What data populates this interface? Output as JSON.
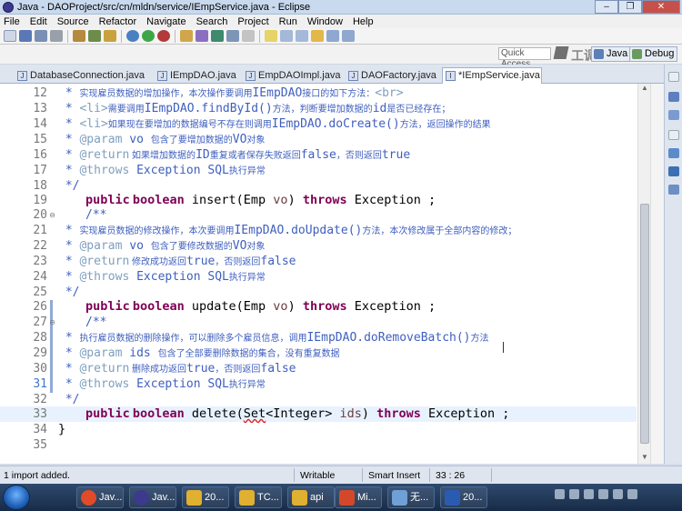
{
  "window": {
    "title": "Java - DAOProject/src/cn/mldn/service/IEmpService.java - Eclipse",
    "controls": [
      "–",
      "❐",
      "✕"
    ]
  },
  "menu": [
    "File",
    "Edit",
    "Source",
    "Refactor",
    "Navigate",
    "Search",
    "Project",
    "Run",
    "Window",
    "Help"
  ],
  "quick_access": "Quick Access",
  "watermark": "工调堂",
  "perspectives": {
    "java": "Java",
    "debug": "Debug"
  },
  "tabs": [
    {
      "label": "DatabaseConnection.java",
      "active": false
    },
    {
      "label": "IEmpDAO.java",
      "active": false
    },
    {
      "label": "EmpDAOImpl.java",
      "active": false
    },
    {
      "label": "DAOFactory.java",
      "active": false
    },
    {
      "label": "*IEmpService.java",
      "active": true
    }
  ],
  "code": {
    "line12": {
      "num": "12",
      "star": " * ",
      "a": "实现雇员数据的增加操作，本次操作要调用",
      "b": "IEmpDAO",
      "c": "接口的如下方法：",
      "d": "<br>"
    },
    "line13": {
      "num": "13",
      "star": " * ",
      "tag": "<li>",
      "a": "需要调用",
      "b": "IEmpDAO.findById()",
      "c": "方法，判断要增加数据的",
      "d": "id",
      "e": "是否已经存在；"
    },
    "line14": {
      "num": "14",
      "star": " * ",
      "tag": "<li>",
      "a": "如果现在要增加的数据编号不存在则调用",
      "b": "IEmpDAO.doCreate()",
      "c": "方法，返回操作的结果"
    },
    "line15": {
      "num": "15",
      "star": " * ",
      "tag": "@param",
      "a": " vo ",
      "b": "包含了要增加数据的",
      "c": "VO",
      "d": "对象"
    },
    "line16": {
      "num": "16",
      "star": " * ",
      "tag": "@return",
      "a": " 如果增加数据的",
      "b": "ID",
      "c": "重复或者保存失败返回",
      "d": "false",
      "e": "，否则返回",
      "f": "true"
    },
    "line17": {
      "num": "17",
      "star": " * ",
      "tag": "@throws",
      "a": " Exception SQL",
      "b": "执行异常"
    },
    "line18": {
      "num": "18",
      "text": " */"
    },
    "line19": {
      "num": "19",
      "kw1": "public",
      "kw2": "boolean",
      "a": " insert(Emp ",
      "p": "vo",
      "b": ") ",
      "kw3": "throws",
      "c": " Exception ;"
    },
    "line20": {
      "num": "20",
      "text": "/**"
    },
    "line21": {
      "num": "21",
      "star": " * ",
      "a": "实现雇员数据的修改操作，本次要调用",
      "b": "IEmpDAO.doUpdate()",
      "c": "方法，本次修改属于全部内容的修改；"
    },
    "line22": {
      "num": "22",
      "star": " * ",
      "tag": "@param",
      "a": " vo ",
      "b": "包含了要修改数据的",
      "c": "VO",
      "d": "对象"
    },
    "line23": {
      "num": "23",
      "star": " * ",
      "tag": "@return",
      "a": " 修改成功返回",
      "b": "true",
      "c": "，否则返回",
      "d": "false"
    },
    "line24": {
      "num": "24",
      "star": " * ",
      "tag": "@throws",
      "a": " Exception SQL",
      "b": "执行异常"
    },
    "line25": {
      "num": "25",
      "text": " */"
    },
    "line26": {
      "num": "26",
      "kw1": "public",
      "kw2": "boolean",
      "a": " update(Emp ",
      "p": "vo",
      "b": ") ",
      "kw3": "throws",
      "c": " Exception ;"
    },
    "line27": {
      "num": "27",
      "text": "/**"
    },
    "line28": {
      "num": "28",
      "star": " * ",
      "a": "执行雇员数据的删除操作，可以删除多个雇员信息，调用",
      "b": "IEmpDAO.doRemoveBatch()",
      "c": "方法"
    },
    "line29": {
      "num": "29",
      "star": " * ",
      "tag": "@param",
      "a": " ids ",
      "b": "包含了全部要删除数据的集合，没有重复数据"
    },
    "line30": {
      "num": "30",
      "star": " * ",
      "tag": "@return",
      "a": " 删除成功返回",
      "b": "true",
      "c": "，否则返回",
      "d": "false"
    },
    "line31": {
      "num": "31",
      "star": " * ",
      "tag": "@throws",
      "a": " Exception SQL",
      "b": "执行异常"
    },
    "line32": {
      "num": "32",
      "text": " */"
    },
    "line33": {
      "num": "33",
      "kw1": "public",
      "kw2": "boolean",
      "a": " delete(",
      "sq": "Set",
      "b": "<Integer> ",
      "p": "ids",
      "c": ") ",
      "kw3": "throws",
      "d": " Exception ;"
    },
    "line34": {
      "num": "34",
      "text": "}"
    },
    "line35": {
      "num": "35",
      "text": ""
    }
  },
  "status": {
    "message": "1 import added.",
    "mode": "Writable",
    "insert": "Smart Insert",
    "position": "33 : 26"
  },
  "taskbar": {
    "items": [
      {
        "label": "Jav...",
        "color": "#e04b2a"
      },
      {
        "label": "Jav...",
        "color": "#3c3a8c"
      },
      {
        "label": "20...",
        "color": "#e0b030"
      },
      {
        "label": "TC...",
        "color": "#e0b030"
      },
      {
        "label": "api",
        "color": "#e0b030"
      },
      {
        "label": "Mi...",
        "color": "#d5472b"
      },
      {
        "label": "无...",
        "color": "#6fa0d8"
      },
      {
        "label": "20...",
        "color": "#2b5bb0"
      }
    ]
  }
}
